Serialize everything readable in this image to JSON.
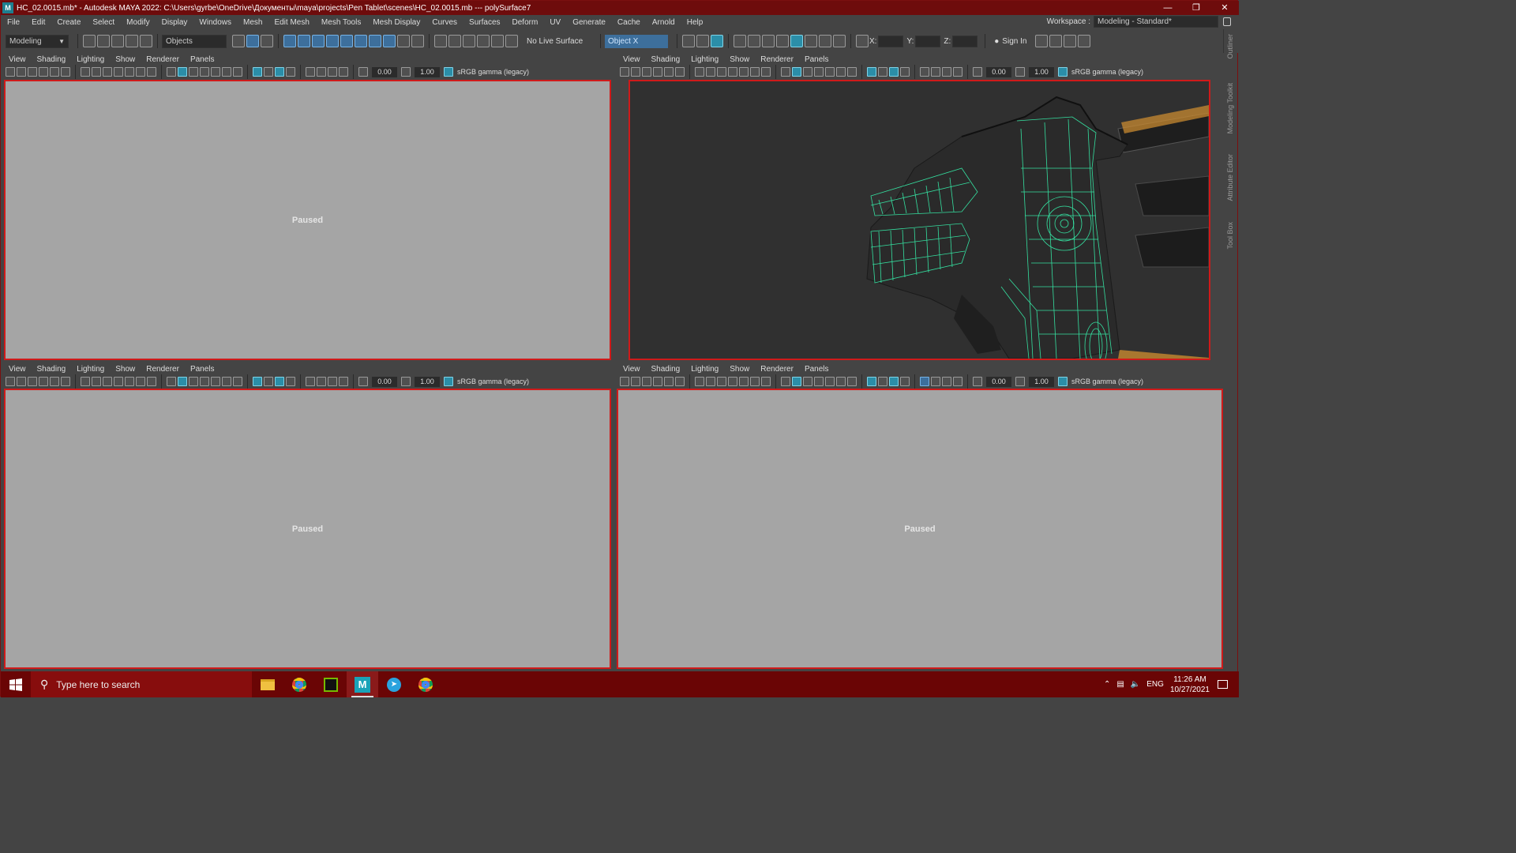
{
  "window": {
    "title": "HC_02.0015.mb* - Autodesk MAYA 2022: C:\\Users\\gyrbe\\OneDrive\\Документы\\maya\\projects\\Pen Tablet\\scenes\\HC_02.0015.mb  ---  polySurface7",
    "logo": "M"
  },
  "menubar": {
    "items": [
      "File",
      "Edit",
      "Create",
      "Select",
      "Modify",
      "Display",
      "Windows",
      "Mesh",
      "Edit Mesh",
      "Mesh Tools",
      "Mesh Display",
      "Curves",
      "Surfaces",
      "Deform",
      "UV",
      "Generate",
      "Cache",
      "Arnold",
      "Help"
    ],
    "workspace_label": "Workspace :",
    "workspace_value": "Modeling - Standard*"
  },
  "statusline": {
    "menuset": "Modeling",
    "select_mode": "Objects",
    "live_surface": "No Live Surface",
    "symmetry": "Object X",
    "x_label": "X:",
    "y_label": "Y:",
    "z_label": "Z:",
    "sign_in": "Sign In"
  },
  "side_tabs": [
    "Outliner",
    "Modeling Toolkit",
    "Attribute Editor",
    "Tool Box"
  ],
  "panel_menu": [
    "View",
    "Shading",
    "Lighting",
    "Show",
    "Renderer",
    "Panels"
  ],
  "panel_toolbar": {
    "exposure": "0.00",
    "gamma": "1.00",
    "colorspace": "sRGB gamma (legacy)"
  },
  "viewports": {
    "top_left": {
      "status": "Paused"
    },
    "top_right": {
      "status": ""
    },
    "bottom_left": {
      "status": "Paused"
    },
    "bottom_right": {
      "status": "Paused"
    }
  },
  "taskbar": {
    "search_placeholder": "Type here to search",
    "apps": [
      "file-explorer",
      "chrome",
      "nvidia",
      "maya",
      "telegram",
      "chrome"
    ],
    "language": "ENG",
    "time": "11:26 AM",
    "date": "10/27/2021"
  },
  "colors": {
    "accent_red": "#d01a1a",
    "taskbar": "#6a0505",
    "wireframe": "#35e0a0"
  }
}
